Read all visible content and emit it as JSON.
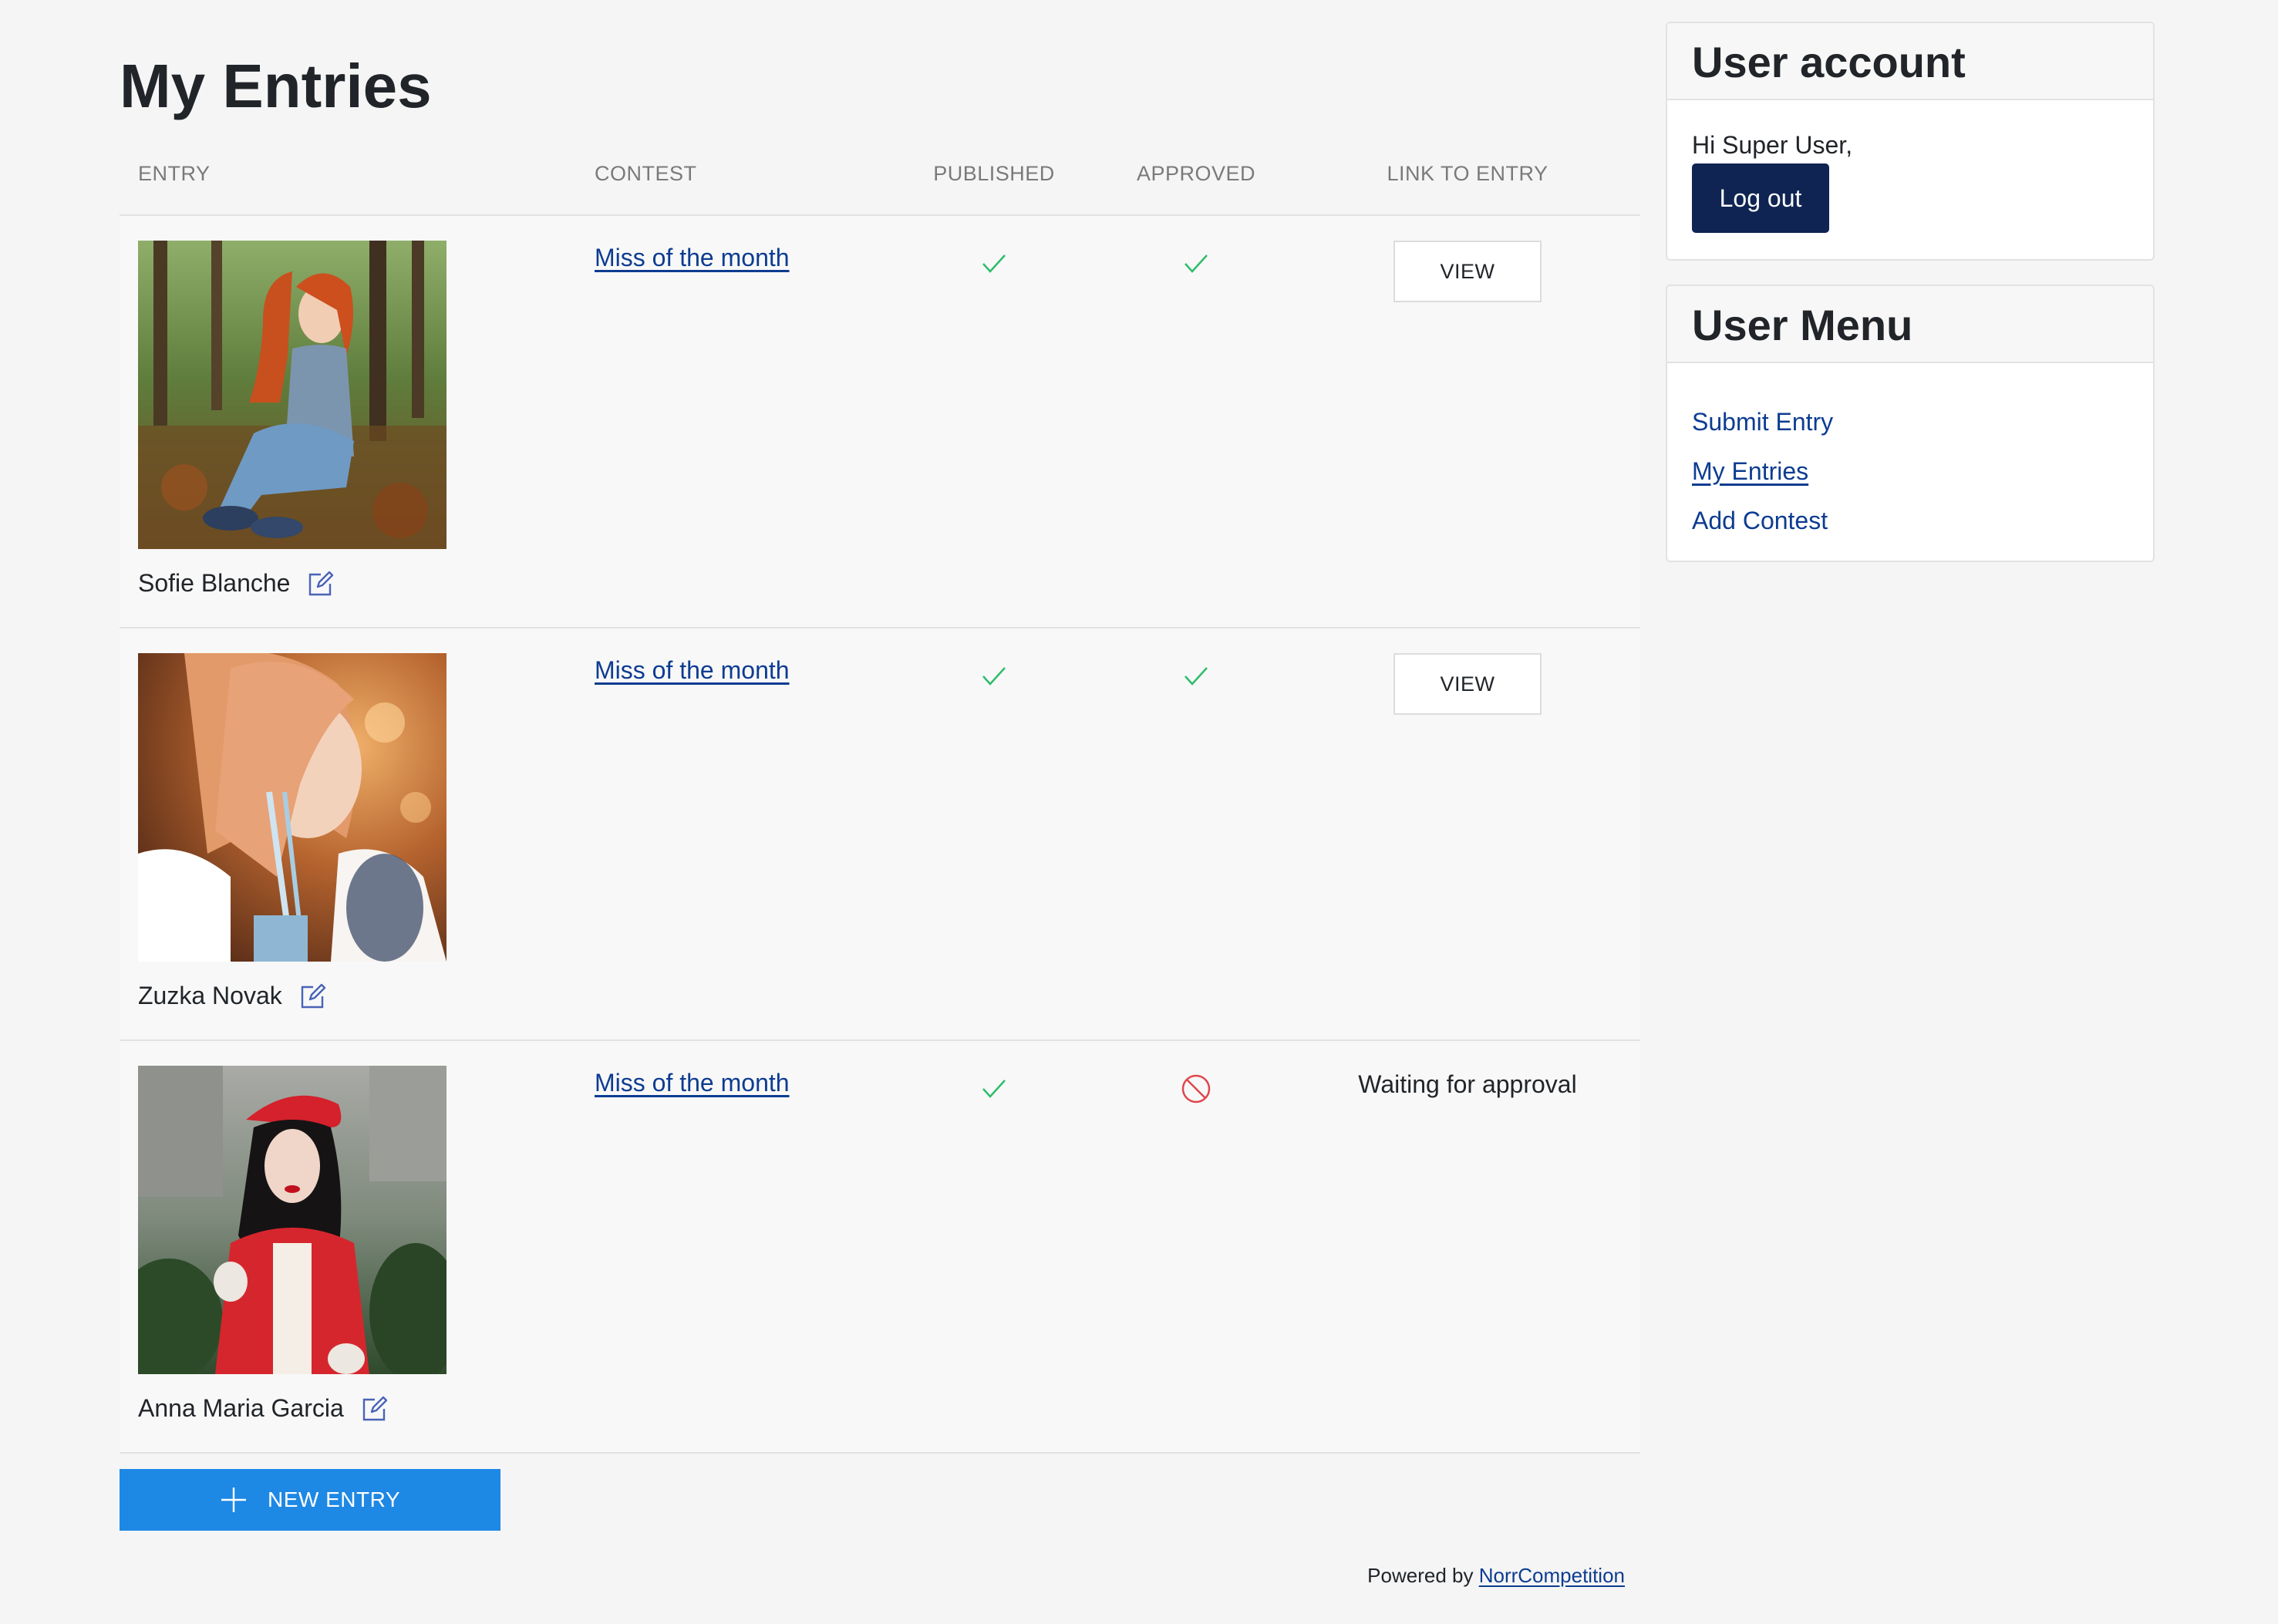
{
  "page": {
    "title": "My Entries"
  },
  "table": {
    "headers": {
      "entry": "ENTRY",
      "contest": "CONTEST",
      "published": "PUBLISHED",
      "approved": "APPROVED",
      "link": "LINK TO ENTRY"
    },
    "rows": [
      {
        "name": "Sofie Blanche",
        "contest": "Miss of the month",
        "published": "check-icon",
        "approved": "check-icon",
        "link_label": "VIEW",
        "status_text": ""
      },
      {
        "name": "Zuzka Novak",
        "contest": "Miss of the month",
        "published": "check-icon",
        "approved": "check-icon",
        "link_label": "VIEW",
        "status_text": ""
      },
      {
        "name": "Anna Maria Garcia",
        "contest": "Miss of the month",
        "published": "check-icon",
        "approved": "ban-icon",
        "link_label": "",
        "status_text": "Waiting for approval"
      }
    ]
  },
  "actions": {
    "new_entry_label": "NEW ENTRY"
  },
  "footer": {
    "powered_by": "Powered by",
    "brand_link": "NorrCompetition"
  },
  "sidebar": {
    "account": {
      "title": "User account",
      "greeting": "Hi Super User,",
      "logout_label": "Log out"
    },
    "menu": {
      "title": "User Menu",
      "items": [
        {
          "label": "Submit Entry"
        },
        {
          "label": "My Entries"
        },
        {
          "label": "Add Contest"
        }
      ]
    }
  },
  "colors": {
    "link": "#0d3c91",
    "check": "#2ebd6b",
    "ban": "#e0464d",
    "primary_button": "#1e88e5",
    "logout_button": "#0f2453"
  }
}
